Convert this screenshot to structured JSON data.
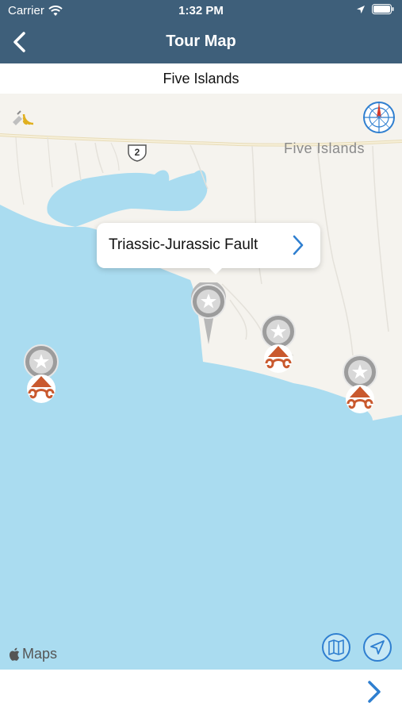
{
  "status_bar": {
    "carrier": "Carrier",
    "time": "1:32 PM"
  },
  "nav": {
    "title": "Tour Map"
  },
  "subtitle": "Five Islands",
  "map": {
    "place_label": "Five Islands",
    "route_number": "2",
    "callout_text": "Triassic-Jurassic Fault",
    "attribution": "Maps"
  },
  "colors": {
    "header": "#3e5f7a",
    "water": "#aadcf0",
    "accent": "#2f7fd0"
  }
}
